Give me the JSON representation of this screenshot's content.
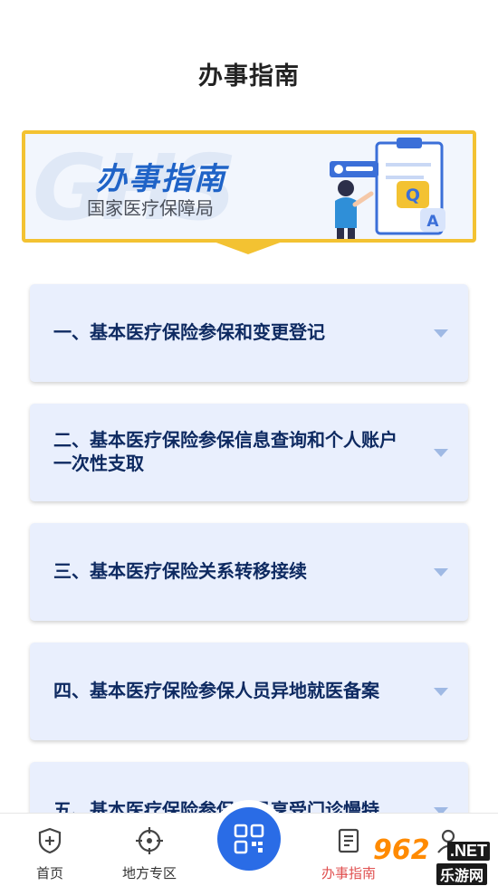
{
  "page": {
    "title": "办事指南"
  },
  "banner": {
    "title": "办事指南",
    "subtitle": "国家医疗保障局",
    "watermark": "GHS",
    "illustration_letters": [
      "Q",
      "A"
    ]
  },
  "guide_items": [
    {
      "label": "一、基本医疗保险参保和变更登记"
    },
    {
      "label": "二、基本医疗保险参保信息查询和个人账户一次性支取"
    },
    {
      "label": "三、基本医疗保险关系转移接续"
    },
    {
      "label": "四、基本医疗保险参保人员异地就医备案"
    },
    {
      "label": "五、基本医疗保险参保人员享受门诊慢特"
    }
  ],
  "tabbar": {
    "tabs": [
      {
        "label": "首页",
        "icon": "shield-plus-icon"
      },
      {
        "label": "地方专区",
        "icon": "target-icon"
      },
      {
        "label": "",
        "icon": "scan-qr-icon"
      },
      {
        "label": "办事指南",
        "icon": "document-icon",
        "active": true
      },
      {
        "label": "",
        "icon": "user-icon"
      }
    ],
    "active_color": "#e05050",
    "scan_color": "#2a6ce6"
  },
  "watermark": {
    "brand": "962",
    "net": ".NET",
    "sub": "乐游网"
  }
}
